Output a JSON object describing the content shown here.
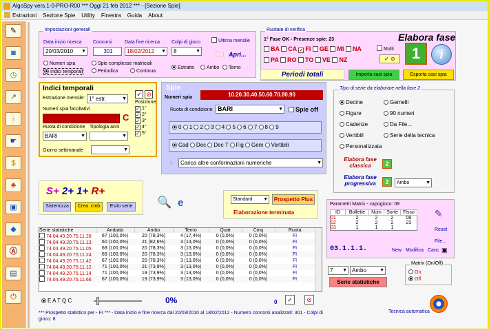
{
  "window": {
    "title": "AlgoSpy vers.1-0-PRO-R00  ***  Oggi 21 feb 2012  ***  - [Sezione Spie]"
  },
  "menu": [
    "Estrazioni",
    "Sezione Spie",
    "Utility",
    "Finestra",
    "Guida",
    "About"
  ],
  "toolbar_icons": [
    "pencil-icon",
    "disk-icon",
    "clock-icon",
    "chart-icon",
    "bulb-icon",
    "hand-icon",
    "dollar-icon",
    "tree-icon",
    "window-icon",
    "diamond-icon",
    "a-icon",
    "book-icon",
    "power-icon"
  ],
  "imp": {
    "title": "Impostazioni generali",
    "start_label": "Data inizio ricerca",
    "start": "20/03/2010",
    "conc_label": "Concorsi",
    "conc": "301",
    "end_label": "Data fine ricerca",
    "end": "18/02/2012",
    "colpi_label": "Colpi di gioco",
    "colpi": "8",
    "ultima": "Ultima mensile",
    "apri": "Apri...",
    "numeri_spia": "Numeri spia",
    "spie_compl": "Spie complesse matriciali",
    "indici": "Indici temporali",
    "periodica": "Periodica",
    "continua": "Continua",
    "estratto": "Estratto",
    "ambo": "Ambo",
    "terno": "Terno"
  },
  "ruotate": {
    "title": "Ruotate di verifica",
    "info": "1° Fase OK - Presenze spie: 23",
    "row1": [
      "BA",
      "CA",
      "FI",
      "GE",
      "MI",
      "NA"
    ],
    "row2": [
      "PA",
      "RO",
      "TO",
      "VE",
      "NZ"
    ],
    "multi": "Multi",
    "elabora": "Elabora fase",
    "periodi": "Periodi totali",
    "importa": "Importa casi spia",
    "esporta": "Esporta casi spia"
  },
  "indici": {
    "title": "Indici temporali",
    "estr_label": "Estrazione mensile:",
    "estr": "1° estr.",
    "numeri_label": "Numeri spia facoltativi",
    "ruota_label": "Ruota di condizione",
    "ruota": "BARI",
    "tipo_label": "Tipologia anni",
    "giorno_label": "Giorno settimanale",
    "posizione": "Posizione",
    "pos": [
      "1°",
      "2°",
      "3°",
      "4°",
      "5°"
    ]
  },
  "spie": {
    "title": "Spie",
    "numeri_label": "Numeri spia",
    "numeri": "10.20.30.40.50.60.70.80.90",
    "ruota_label": "Ruota di condizione",
    "ruota": "BARI",
    "spie_off": "Spie off",
    "radios": [
      "0",
      "1",
      "2",
      "3",
      "4",
      "5",
      "6",
      "7",
      "8",
      "9"
    ],
    "modes": [
      "Cad",
      "Dec",
      "Dec T",
      "Fig",
      "Gem",
      "Vertibili"
    ],
    "carica": "Carica altre conformazioni numeriche"
  },
  "serie": {
    "title": "Tipo di serie da elaborare nella fase 2",
    "col1": [
      "Decine",
      "Figure",
      "Cadenze",
      "Vertibili",
      "Personalizzata"
    ],
    "col2": [
      "Gemelli",
      "90 numeri",
      "Da File...",
      "Serie della tecnica"
    ],
    "fase_classica": "Elabora fase classica",
    "fase_progressiva": "Elabora fase progressiva",
    "progr_sel": "Ambo"
  },
  "mid": {
    "sistemizza": "Sistemizza",
    "crea": "Crea .cmb",
    "esito": "Esito serie",
    "standard": "Standard",
    "prospetto": "Prospetto Plus",
    "terminata": "Elaborazione terminata"
  },
  "matrix": {
    "title": "Parametri Matrix - capogioco: 08",
    "headers": [
      "ID",
      "Bollette",
      "Num",
      "Sorte",
      "Fisso"
    ],
    "rows": [
      [
        "01",
        "2",
        "2",
        "2",
        "08"
      ],
      [
        "02",
        "2",
        "2",
        "2",
        "23"
      ],
      [
        "03",
        "1",
        "1",
        "1",
        ""
      ]
    ],
    "reset": "Reset",
    "file": "File...",
    "code": "03.1.1.1.",
    "new": "New",
    "modifica": "Modifica",
    "canc": "Canc"
  },
  "bottom_right": {
    "n": "7",
    "sel": "Ambo",
    "serie_btn": "Serie statistiche",
    "matrix_title": "Matrix (On/Off)",
    "on": "On",
    "off": "Off",
    "tecnica": "Tecnica automatica"
  },
  "stats": {
    "headers": [
      "Serie statistiche",
      "Ambata",
      "Ambo",
      "Terno",
      "Quat",
      "Cinq",
      "Ruota"
    ],
    "rows": [
      [
        "74.04.49.20.75.11.28",
        "67 (100,0%)",
        "20 (78,3%)",
        "4 (17,4%)",
        "0 (0,0%)",
        "0 (0,0%)",
        "FI"
      ],
      [
        "74.04.49.20.75.11.13",
        "60 (100,0%)",
        "21 (82,6%)",
        "3 (13,0%)",
        "0 (0,0%)",
        "0 (0,0%)",
        "FI"
      ],
      [
        "74.04.49.20.75.11.05",
        "68 (100,0%)",
        "20 (78,3%)",
        "3 (13,0%)",
        "0 (0,0%)",
        "0 (0,0%)",
        "FI"
      ],
      [
        "74.04.49.20.75.11.24",
        "69 (100,0%)",
        "20 (78,3%)",
        "3 (13,0%)",
        "0 (0,0%)",
        "0 (0,0%)",
        "FI"
      ],
      [
        "74.04.49.20.75.11.42",
        "67 (100,0%)",
        "20 (78,3%)",
        "3 (13,0%)",
        "0 (0,0%)",
        "0 (0,0%)",
        "FI"
      ],
      [
        "74.04.49.20.75.11.12",
        "71 (100,0%)",
        "21 (73,9%)",
        "3 (13,0%)",
        "0 (0,0%)",
        "0 (0,0%)",
        "FI"
      ],
      [
        "74.04.49.20.75.11.14",
        "71 (100,0%)",
        "19 (73,9%)",
        "3 (13,0%)",
        "0 (0,0%)",
        "0 (0,0%)",
        "FI"
      ],
      [
        "74.04.49.20.75.11.66",
        "67 (100,0%)",
        "19 (73,9%)",
        "3 (13,0%)",
        "0 (0,0%)",
        "0 (0,0%)",
        "FI"
      ]
    ]
  },
  "footer": {
    "radios": "E A T Q C",
    "percent": "0%",
    "zero": "0",
    "status": "*** Prospetto statistico per  - FI ***  - Data inizio e fine ricerca dal 20/03/2010 al 18/02/2012 - Numero concorsi analizzati: 301 - Colpi di gioco: 8"
  },
  "colors": {
    "accent": "#c00000",
    "orange": "#f4b470",
    "yellow": "#ffffc0",
    "lilac": "#ccccff",
    "pink": "#ffd8ff"
  }
}
